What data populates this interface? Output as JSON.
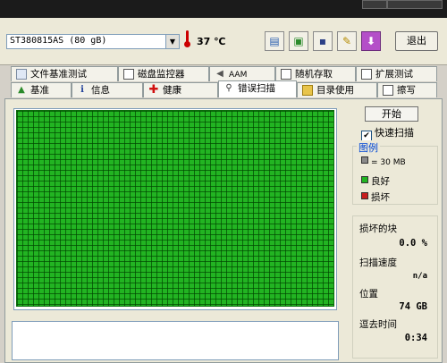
{
  "toolbar": {
    "drive": "ST380815AS (80 gB)",
    "temperature": "37 ℃",
    "exit_label": "退出"
  },
  "tabs": {
    "row1": [
      "文件基准测试",
      "磁盘监控器",
      "AAM",
      "随机存取",
      "扩展测试"
    ],
    "row2": [
      "基准",
      "信息",
      "健康",
      "错误扫描",
      "目录使用",
      "擦写"
    ],
    "active": "错误扫描"
  },
  "scan": {
    "start_label": "开始",
    "quick_scan_label": "快速扫描",
    "quick_scan_checked": true
  },
  "legend": {
    "title": "图例",
    "block_size": "= 30 MB",
    "good": "良好",
    "bad": "损坏",
    "good_color": "#22b422",
    "bad_color": "#c81e1e"
  },
  "stats": {
    "damaged_blocks_label": "损坏的块",
    "damaged_blocks_value": "0.0 %",
    "scan_speed_label": "扫描速度",
    "scan_speed_value": "n/a",
    "position_label": "位置",
    "position_value": "74 GB",
    "elapsed_label": "逗去时间",
    "elapsed_value": "0:34"
  }
}
